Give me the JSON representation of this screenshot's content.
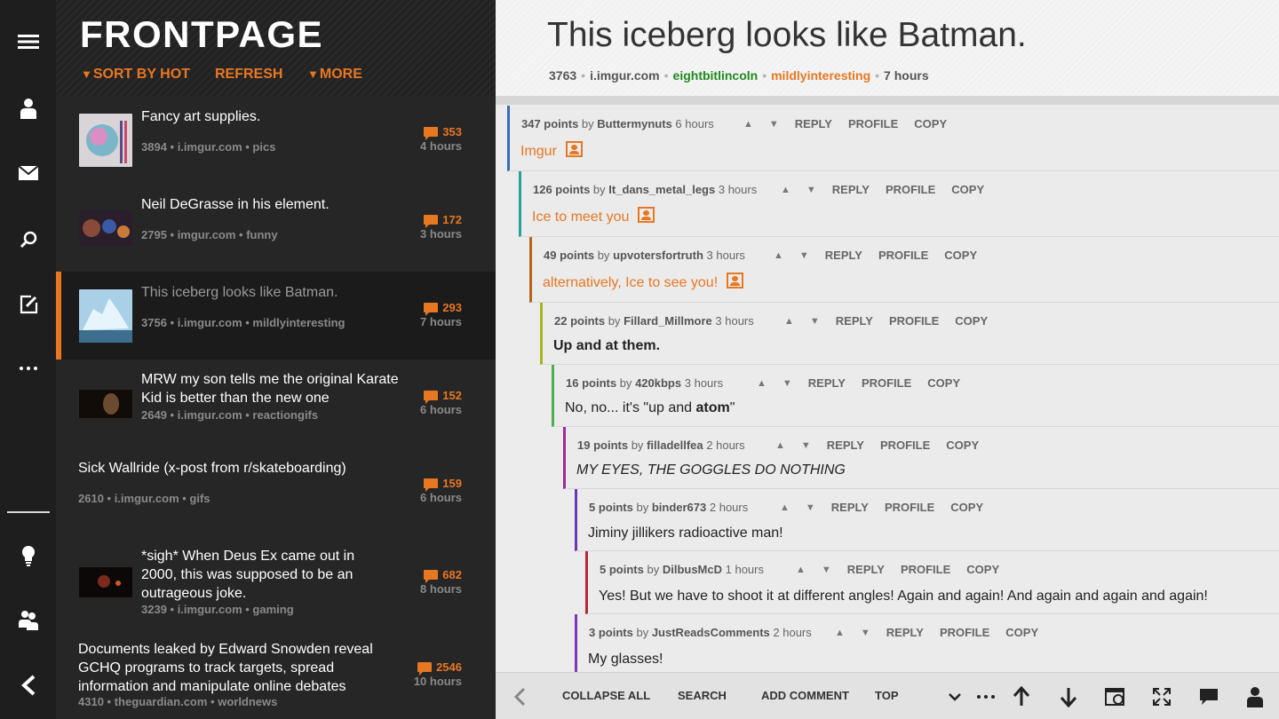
{
  "list": {
    "title": "FRONTPAGE",
    "sort_label": "SORT BY HOT",
    "refresh_label": "REFRESH",
    "more_label": "MORE",
    "posts": [
      {
        "title": "Fancy art supplies.",
        "meta": "3894 • i.imgur.com • pics",
        "comments": "353",
        "age": "4 hours"
      },
      {
        "title": "Neil DeGrasse in his element.",
        "meta": "2795 • imgur.com • funny",
        "comments": "172",
        "age": "3 hours"
      },
      {
        "title": "This iceberg looks like Batman.",
        "meta": "3756 • i.imgur.com • mildlyinteresting",
        "comments": "293",
        "age": "7 hours"
      },
      {
        "title": "MRW my son tells me the original Karate Kid is better than the new one",
        "meta": "2649 • i.imgur.com • reactiongifs",
        "comments": "152",
        "age": "6 hours"
      },
      {
        "title": "Sick Wallride (x-post from r/skateboarding)",
        "meta": "2610 • i.imgur.com • gifs",
        "comments": "159",
        "age": "6 hours"
      },
      {
        "title": "*sigh* When Deus Ex came out in 2000, this was supposed to be an outrageous joke.",
        "meta": "3239 • i.imgur.com • gaming",
        "comments": "682",
        "age": "8 hours"
      },
      {
        "title": "Documents leaked by Edward Snowden reveal GCHQ programs to track targets, spread information and manipulate online debates",
        "meta": "4310 • theguardian.com • worldnews",
        "comments": "2546",
        "age": "10 hours"
      }
    ]
  },
  "detail": {
    "title": "This iceberg looks like Batman.",
    "score": "3763",
    "domain": "i.imgur.com",
    "author": "eightbitlincoln",
    "subreddit": "mildlyinteresting",
    "age": "7 hours",
    "sep": "•"
  },
  "comment_actions": {
    "reply": "REPLY",
    "profile": "PROFILE",
    "copy": "COPY",
    "up": "▲",
    "down": "▼"
  },
  "comments": [
    {
      "points": "347 points",
      "by": "by",
      "author": "Buttermynuts",
      "age": "6 hours",
      "body": "Imgur",
      "color": "#3a6db5"
    },
    {
      "points": "126 points",
      "by": "by",
      "author": "It_dans_metal_legs",
      "age": "3 hours",
      "body": "Ice to meet you",
      "color": "#2aa198"
    },
    {
      "points": "49 points",
      "by": "by",
      "author": "upvotersfortruth",
      "age": "3 hours",
      "body": "alternatively, Ice to see you!",
      "color": "#b5651d"
    },
    {
      "points": "22 points",
      "by": "by",
      "author": "Fillard_Millmore",
      "age": "3 hours",
      "body": "Up and at them.",
      "color": "#a8b41e"
    },
    {
      "points": "16 points",
      "by": "by",
      "author": "420kbps",
      "age": "3 hours",
      "body_pre": "No, no... it's \"up and ",
      "body_bold": "atom",
      "body_post": "\"",
      "color": "#4caf50"
    },
    {
      "points": "19 points",
      "by": "by",
      "author": "filladellfea",
      "age": "2 hours",
      "body": "MY EYES, THE GOGGLES DO NOTHING",
      "color": "#9b2a9b"
    },
    {
      "points": "5 points",
      "by": "by",
      "author": "binder673",
      "age": "2 hours",
      "body": "Jiminy jillikers radioactive man!",
      "color": "#6a3ab5"
    },
    {
      "points": "5 points",
      "by": "by",
      "author": "DilbusMcD",
      "age": "1 hours",
      "body": "Yes! But we have to shoot it at different angles! Again and again! And again and again and again!",
      "color": "#b5283a"
    },
    {
      "points": "3 points",
      "by": "by",
      "author": "JustReadsComments",
      "age": "2 hours",
      "body": "My glasses!",
      "color": "#7a3ab5"
    }
  ],
  "appbar": {
    "collapse_all": "COLLAPSE ALL",
    "search": "SEARCH",
    "add_comment": "ADD COMMENT",
    "sort": "TOP"
  },
  "colors": {
    "accent": "#e87722",
    "author_green": "#1e8a1e"
  }
}
